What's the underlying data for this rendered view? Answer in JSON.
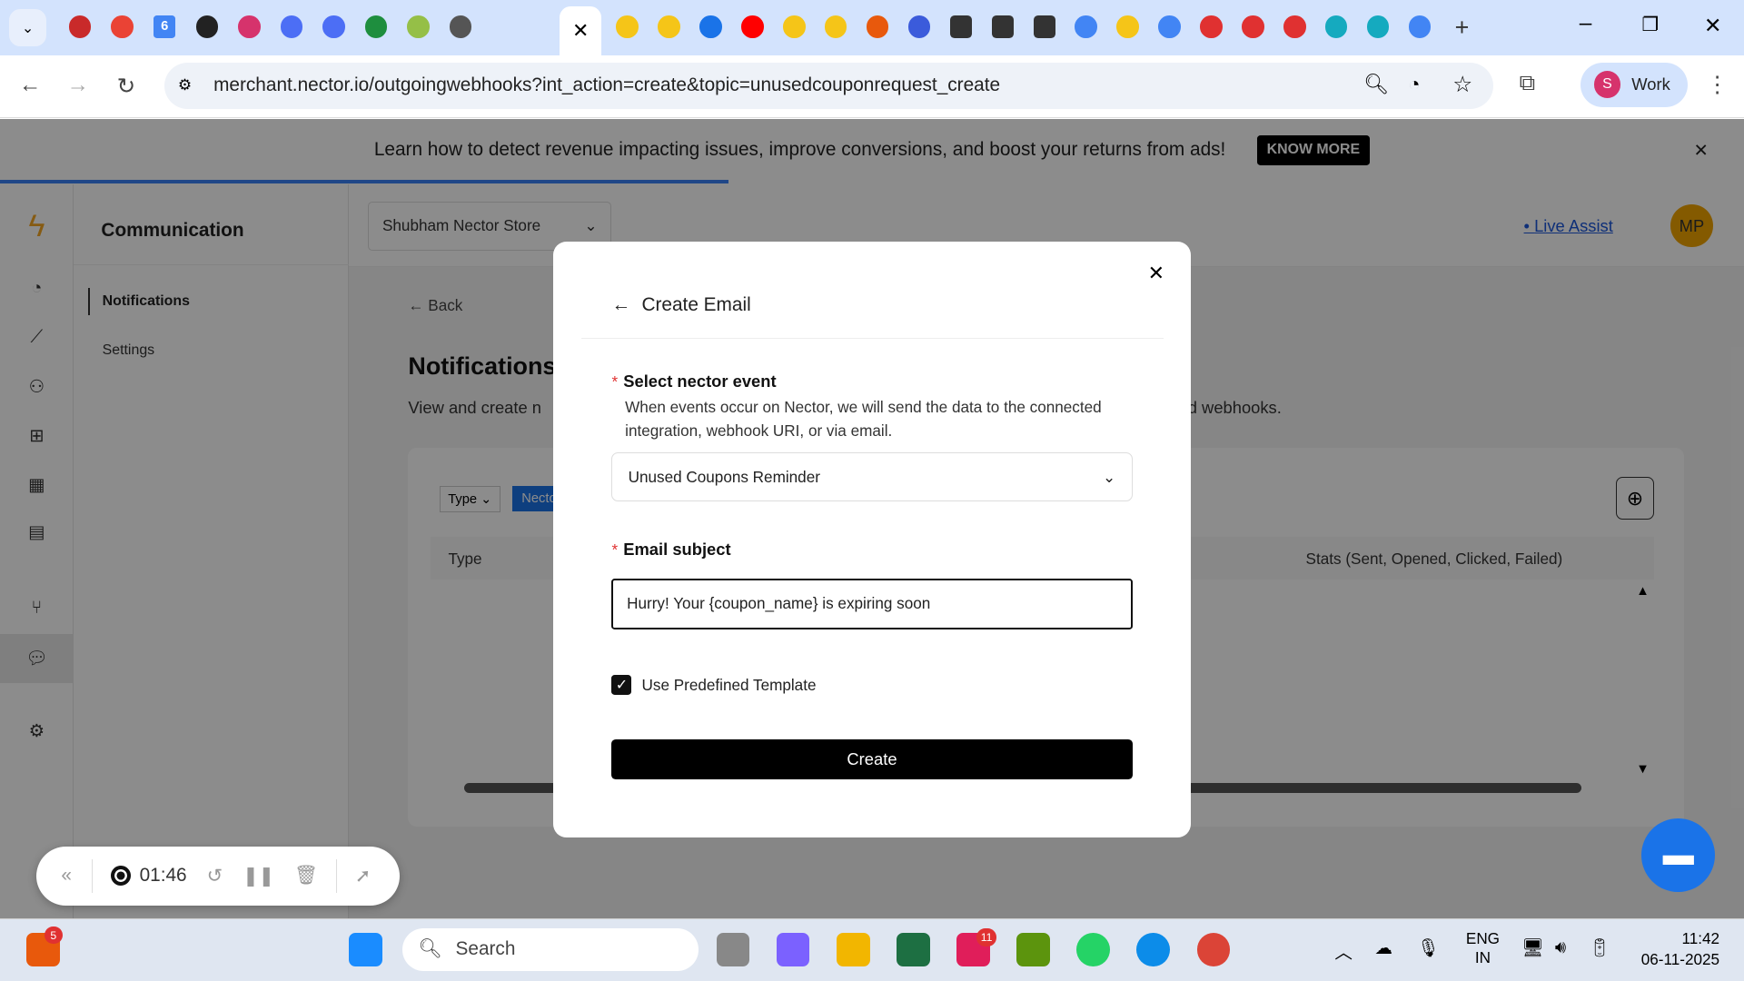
{
  "browser": {
    "url": "merchant.nector.io/outgoingwebhooks?int_action=create&topic=unusedcouponrequest_create",
    "profile_initial": "S",
    "profile_label": "Work",
    "tab_icons": [
      "record-icon",
      "gmail-icon",
      "calendar-icon",
      "openai-icon",
      "monday-icon",
      "docs-icon",
      "docs-icon",
      "sheets-icon",
      "shopify-icon",
      "globe-icon",
      "nector-icon",
      "nector-icon",
      "chat-icon",
      "youtube-icon",
      "nector-icon",
      "nector-icon",
      "puzzle-icon",
      "loop-icon",
      "box-icon",
      "box-icon",
      "box-icon",
      "google-icon",
      "nector-icon",
      "google-icon",
      "airbnb-icon",
      "airbnb-icon",
      "airbnb-icon",
      "grammarly-icon",
      "grammarly-icon",
      "google-icon"
    ],
    "calendar_day": "6"
  },
  "banner": {
    "text": "Learn how to detect revenue impacting issues, improve conversions, and boost your returns from ads!",
    "button": "KNOW MORE"
  },
  "app": {
    "section_title": "Communication",
    "subnav": [
      "Notifications",
      "Settings"
    ],
    "store_select": "Shubham Nector Store",
    "live_assist": "Live Assist",
    "user_initials": "MP",
    "back": "Back",
    "page_title": "Notifications",
    "page_desc_start": "View and create n",
    "page_desc_end": "d webhooks.",
    "filter_type": "Type",
    "filter_nector": "Necto",
    "col_type": "Type",
    "col_stats": "Stats (Sent, Opened, Clicked, Failed)"
  },
  "modal": {
    "title": "Create Email",
    "event_label": "Select nector event",
    "event_help": "When events occur on Nector, we will send the data to the connected integration, webhook URI, or via email.",
    "event_value": "Unused Coupons Reminder",
    "subject_label": "Email subject",
    "subject_value": "Hurry! Your {coupon_name} is expiring soon",
    "template_label": "Use Predefined Template",
    "template_checked": true,
    "create_button": "Create"
  },
  "recorder": {
    "time": "01:46"
  },
  "taskbar": {
    "search_placeholder": "Search",
    "notif_badge": "5",
    "slack_badge": "11",
    "lang_top": "ENG",
    "lang_bottom": "IN",
    "time": "11:42",
    "date": "06-11-2025"
  }
}
